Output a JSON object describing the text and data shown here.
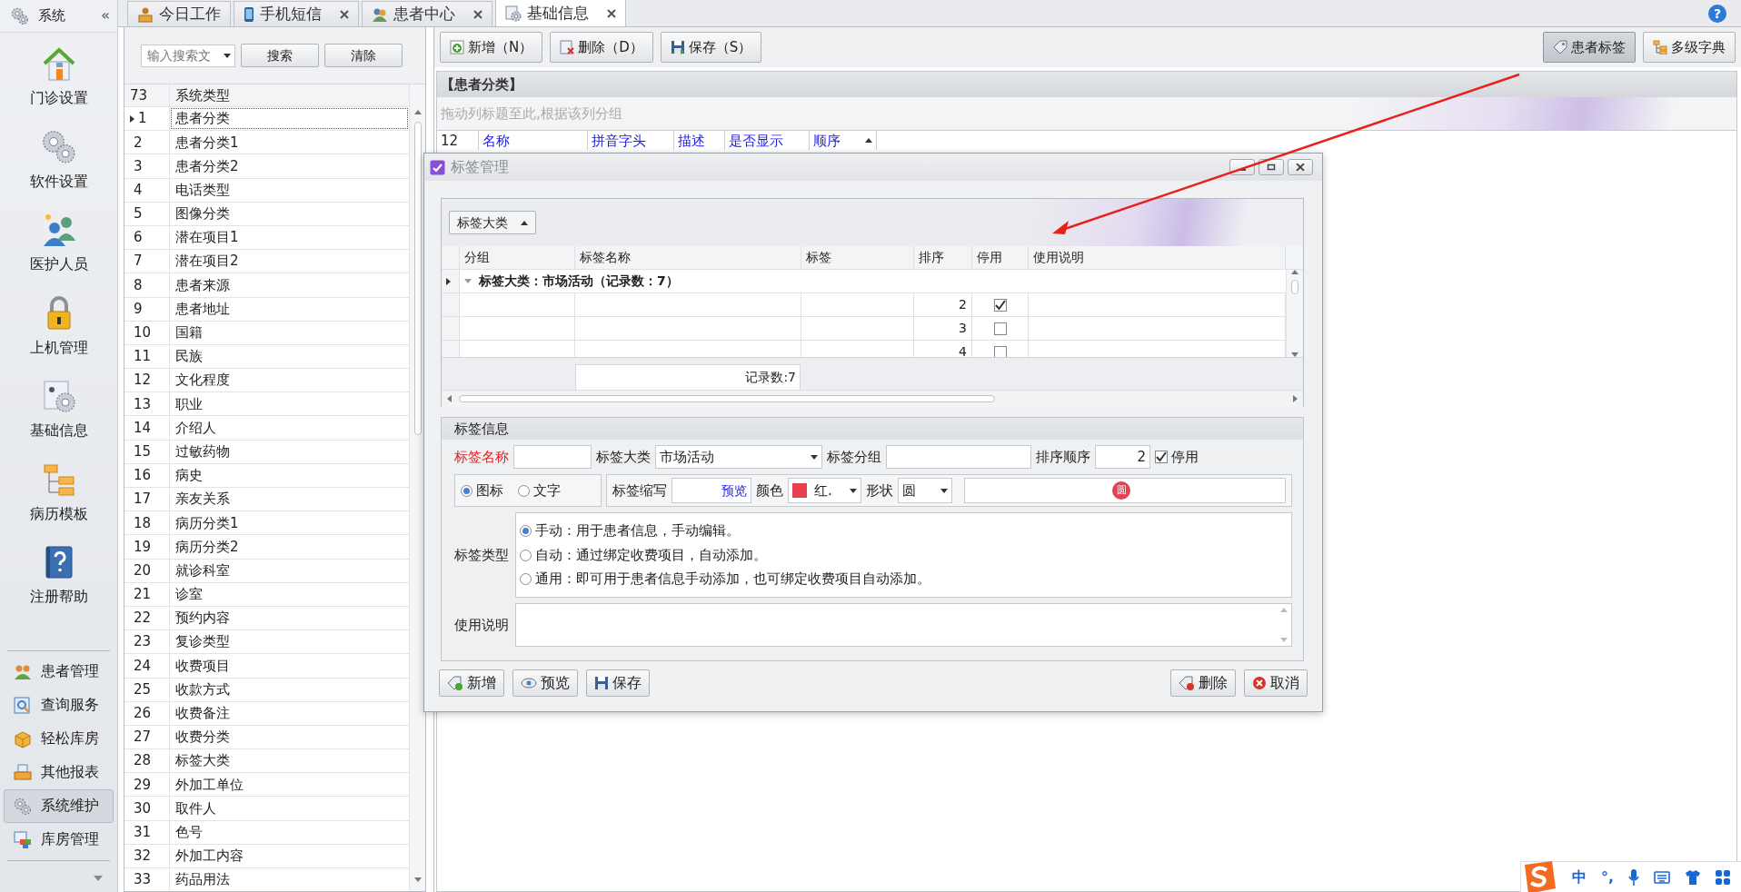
{
  "nav": {
    "title": "系统",
    "collapse": "«",
    "large_items": [
      {
        "label": "门诊设置"
      },
      {
        "label": "软件设置"
      },
      {
        "label": "医护人员"
      },
      {
        "label": "上机管理"
      },
      {
        "label": "基础信息"
      },
      {
        "label": "病历模板"
      },
      {
        "label": "注册帮助"
      }
    ],
    "small_items": [
      {
        "label": "患者管理",
        "selected": false
      },
      {
        "label": "查询服务",
        "selected": false
      },
      {
        "label": "轻松库房",
        "selected": false
      },
      {
        "label": "其他报表",
        "selected": false
      },
      {
        "label": "系统维护",
        "selected": true
      },
      {
        "label": "库房管理",
        "selected": false
      }
    ]
  },
  "tabs": [
    {
      "label": "今日工作",
      "closable": false,
      "selected": false
    },
    {
      "label": "手机短信",
      "closable": true,
      "selected": false
    },
    {
      "label": "患者中心",
      "closable": true,
      "selected": false
    },
    {
      "label": "基础信息",
      "closable": true,
      "selected": true
    }
  ],
  "help": "?",
  "list": {
    "search_placeholder": "输入搜索文",
    "buttons": [
      "搜索",
      "清除"
    ],
    "count": "73",
    "column": "系统类型",
    "rows": [
      {
        "no": "1",
        "name": "患者分类",
        "selected": true
      },
      {
        "no": "2",
        "name": "患者分类1",
        "selected": false
      },
      {
        "no": "3",
        "name": "患者分类2",
        "selected": false
      },
      {
        "no": "4",
        "name": "电话类型",
        "selected": false
      },
      {
        "no": "5",
        "name": "图像分类",
        "selected": false
      },
      {
        "no": "6",
        "name": "潜在项目1",
        "selected": false
      },
      {
        "no": "7",
        "name": "潜在项目2",
        "selected": false
      },
      {
        "no": "8",
        "name": "患者来源",
        "selected": false
      },
      {
        "no": "9",
        "name": "患者地址",
        "selected": false
      },
      {
        "no": "10",
        "name": "国籍",
        "selected": false
      },
      {
        "no": "11",
        "name": "民族",
        "selected": false
      },
      {
        "no": "12",
        "name": "文化程度",
        "selected": false
      },
      {
        "no": "13",
        "name": "职业",
        "selected": false
      },
      {
        "no": "14",
        "name": "介绍人",
        "selected": false
      },
      {
        "no": "15",
        "name": "过敏药物",
        "selected": false
      },
      {
        "no": "16",
        "name": "病史",
        "selected": false
      },
      {
        "no": "17",
        "name": "亲友关系",
        "selected": false
      },
      {
        "no": "18",
        "name": "病历分类1",
        "selected": false
      },
      {
        "no": "19",
        "name": "病历分类2",
        "selected": false
      },
      {
        "no": "20",
        "name": "就诊科室",
        "selected": false
      },
      {
        "no": "21",
        "name": "诊室",
        "selected": false
      },
      {
        "no": "22",
        "name": "预约内容",
        "selected": false
      },
      {
        "no": "23",
        "name": "复诊类型",
        "selected": false
      },
      {
        "no": "24",
        "name": "收费项目",
        "selected": false
      },
      {
        "no": "25",
        "name": "收款方式",
        "selected": false
      },
      {
        "no": "26",
        "name": "收费备注",
        "selected": false
      },
      {
        "no": "27",
        "name": "收费分类",
        "selected": false
      },
      {
        "no": "28",
        "name": "标签大类",
        "selected": false
      },
      {
        "no": "29",
        "name": "外加工单位",
        "selected": false
      },
      {
        "no": "30",
        "name": "取件人",
        "selected": false
      },
      {
        "no": "31",
        "name": "色号",
        "selected": false
      },
      {
        "no": "32",
        "name": "外加工内容",
        "selected": false
      },
      {
        "no": "33",
        "name": "药品用法",
        "selected": false
      }
    ]
  },
  "main": {
    "toolbar": [
      "新增（N）",
      "删除（D）",
      "保存（S）"
    ],
    "right_buttons": [
      {
        "label": "患者标签",
        "selected": true
      },
      {
        "label": "多级字典",
        "selected": false
      }
    ],
    "grid_title": "【患者分类】",
    "group_hint": "拖动列标题至此,根据该列分组",
    "count": "12",
    "columns": [
      {
        "label": "名称",
        "sorted": false
      },
      {
        "label": "拼音字头",
        "sorted": false
      },
      {
        "label": "描述",
        "sorted": false
      },
      {
        "label": "是否显示",
        "sorted": false
      },
      {
        "label": "顺序",
        "sorted": true
      }
    ]
  },
  "dialog": {
    "title": "标签管理",
    "group_by": "标签大类",
    "columns": [
      "分组",
      "标签名称",
      "标签",
      "排序",
      "停用",
      "使用说明"
    ],
    "group_row": "标签大类：市场活动（记录数：7）",
    "rows": [
      {
        "order": "2",
        "checked": true
      },
      {
        "order": "3",
        "checked": false
      },
      {
        "order": "4",
        "checked": false
      }
    ],
    "footer": "记录数:7",
    "info": {
      "title": "标签信息",
      "name_label": "标签名称",
      "category_label": "标签大类",
      "category": "市场活动",
      "group_label": "标签分组",
      "order_label": "排序顺序",
      "order": "2",
      "disable_label": "停用",
      "disable_checked": true,
      "display_modes": [
        {
          "label": "图标",
          "selected": true
        },
        {
          "label": "文字",
          "selected": false
        }
      ],
      "abbr_label": "标签缩写",
      "preview_link": "预览",
      "color_label": "颜色",
      "color": "#e8404f",
      "color_name": "红.",
      "shape_label": "形状",
      "shape": "圆",
      "badge": "圆",
      "type_label": "标签类型",
      "types": [
        {
          "label": "手动：用于患者信息，手动编辑。",
          "selected": true
        },
        {
          "label": "自动：通过绑定收费项目，自动添加。",
          "selected": false
        },
        {
          "label": "通用：即可用于患者信息手动添加，也可绑定收费项目自动添加。",
          "selected": false
        }
      ],
      "note_label": "使用说明"
    },
    "left_buttons": [
      "新增",
      "预览",
      "保存"
    ],
    "right_buttons": [
      "删除",
      "取消"
    ]
  },
  "ime": {
    "mode": "中",
    "punct": "°,"
  }
}
